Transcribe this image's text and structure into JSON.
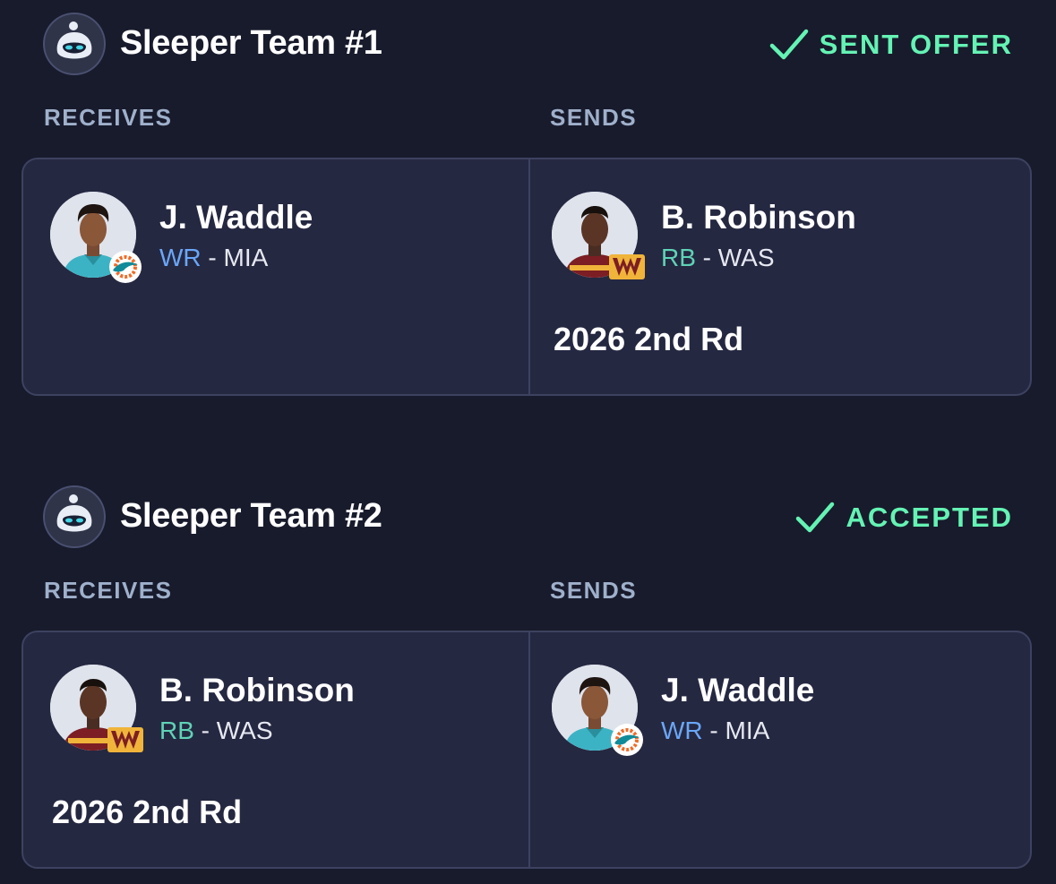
{
  "colors": {
    "background": "#181b2c",
    "card": "#252841",
    "accent_status": "#64f3b4",
    "position_wr": "#6aa7f7",
    "position_rb": "#5fd3b6",
    "column_label": "#9fb0cb"
  },
  "trades": [
    {
      "team_name": "Sleeper Team #1",
      "status_icon": "checkmark-icon",
      "status_label": "SENT OFFER",
      "receives_label": "RECEIVES",
      "sends_label": "SENDS",
      "receives": {
        "player": {
          "name": "J. Waddle",
          "position": "WR",
          "separator": " - ",
          "team": "MIA",
          "logo": "dolphins-logo-icon"
        },
        "pick": ""
      },
      "sends": {
        "player": {
          "name": "B. Robinson",
          "position": "RB",
          "separator": " - ",
          "team": "WAS",
          "logo": "commanders-logo-icon"
        },
        "pick": "2026 2nd Rd"
      }
    },
    {
      "team_name": "Sleeper Team #2",
      "status_icon": "checkmark-icon",
      "status_label": "ACCEPTED",
      "receives_label": "RECEIVES",
      "sends_label": "SENDS",
      "receives": {
        "player": {
          "name": "B. Robinson",
          "position": "RB",
          "separator": " - ",
          "team": "WAS",
          "logo": "commanders-logo-icon"
        },
        "pick": "2026 2nd Rd"
      },
      "sends": {
        "player": {
          "name": "J. Waddle",
          "position": "WR",
          "separator": " - ",
          "team": "MIA",
          "logo": "dolphins-logo-icon"
        },
        "pick": ""
      }
    }
  ]
}
